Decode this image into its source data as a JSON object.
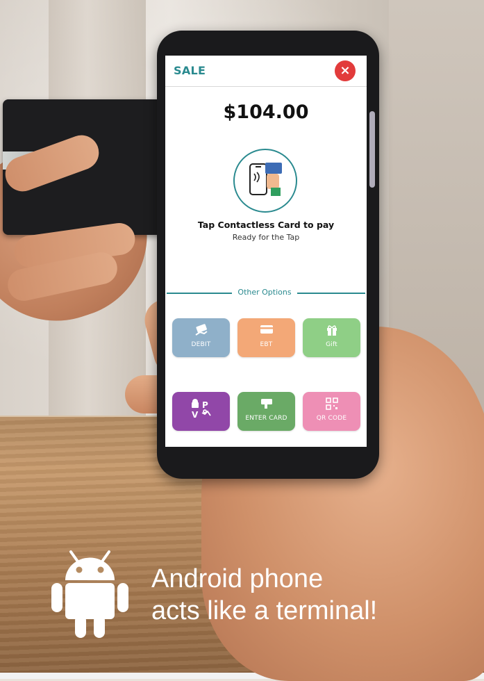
{
  "app": {
    "title": "SALE",
    "close_icon": "×",
    "amount": "$104.00",
    "tap_title": "Tap Contactless Card to pay",
    "tap_subtitle": "Ready for the Tap",
    "other_options_label": "Other Options"
  },
  "options": [
    {
      "label": "DEBIT",
      "icon": "card-hand-icon",
      "color": "#8fb0c9"
    },
    {
      "label": "EBT",
      "icon": "card-icon",
      "color": "#f3a877"
    },
    {
      "label": "Gift",
      "icon": "gift-icon",
      "color": "#8fcf86"
    },
    {
      "label": "",
      "icon": "wallets-icon",
      "color": "#9147a8"
    },
    {
      "label": "ENTER CARD",
      "icon": "enter-card-icon",
      "color": "#6aaa66"
    },
    {
      "label": "QR CODE",
      "icon": "qr-code-icon",
      "color": "#ee8fb5"
    }
  ],
  "tagline": {
    "line1": "Android phone",
    "line2": "acts like a terminal!"
  },
  "colors": {
    "accent": "#2a8a8f",
    "close": "#e23b3b"
  }
}
